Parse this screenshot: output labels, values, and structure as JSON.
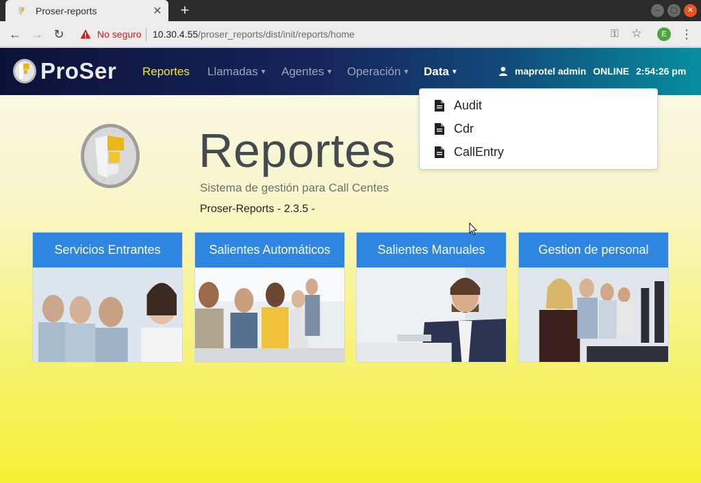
{
  "browser": {
    "tab_title": "Proser-reports",
    "new_tab": "+",
    "security_label": "No seguro",
    "url_host": "10.30.4.55",
    "url_path": "/proser_reports/dist/init/reports/home",
    "profile_initial": "E"
  },
  "nav": {
    "brand": "ProSer",
    "items": [
      {
        "label": "Reportes",
        "state": "active"
      },
      {
        "label": "Llamadas",
        "state": "dropdown"
      },
      {
        "label": "Agentes",
        "state": "dropdown"
      },
      {
        "label": "Operación",
        "state": "dropdown"
      },
      {
        "label": "Data",
        "state": "open"
      }
    ],
    "user": "maprotel admin",
    "status": "ONLINE",
    "time": "2:54:26 pm"
  },
  "dropdown": {
    "items": [
      {
        "label": "Audit",
        "icon": "file-icon"
      },
      {
        "label": "Cdr",
        "icon": "file-icon"
      },
      {
        "label": "CallEntry",
        "icon": "file-icon"
      }
    ]
  },
  "hero": {
    "title": "Reportes",
    "subtitle": "Sistema de gestión para Call Centes",
    "version": "Proser-Reports - 2.3.5 -"
  },
  "cards": [
    {
      "title": "Servicios Entrantes"
    },
    {
      "title": "Salientes Automáticos"
    },
    {
      "title": "Salientes Manuales"
    },
    {
      "title": "Gestion de personal"
    }
  ],
  "colors": {
    "nav_active": "#f3e62c",
    "card_header": "#2f86e0",
    "security_warning": "#c5221f"
  }
}
